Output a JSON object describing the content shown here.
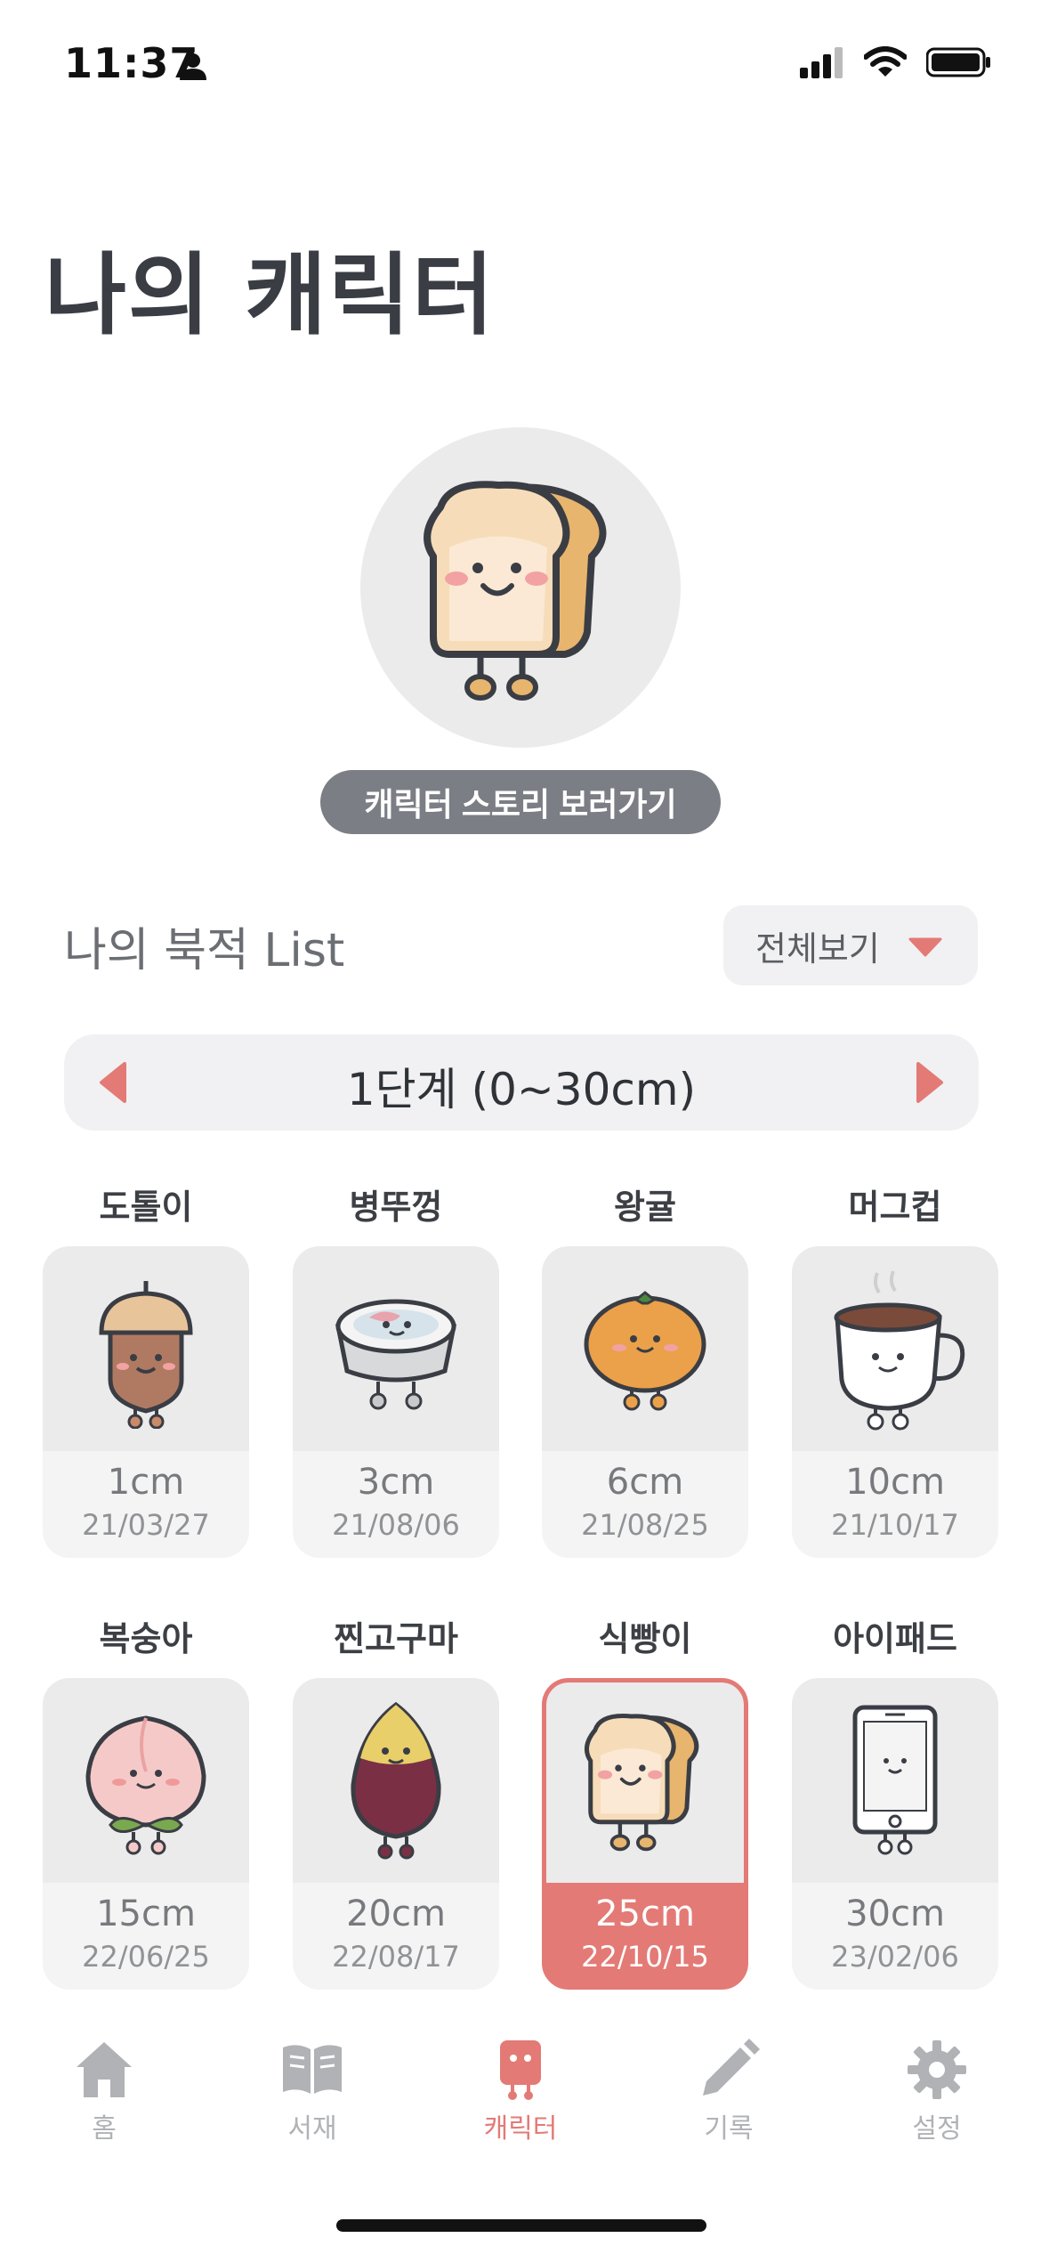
{
  "status": {
    "time": "11:37"
  },
  "page": {
    "title": "나의 캐릭터"
  },
  "hero": {
    "story_button": "캐릭터 스토리 보러가기"
  },
  "list": {
    "title": "나의 북적 List",
    "filter_label": "전체보기"
  },
  "level": {
    "label": "1단계 (0~30cm)"
  },
  "characters": [
    {
      "name": "도톨이",
      "size": "1cm",
      "date": "21/03/27"
    },
    {
      "name": "병뚜껑",
      "size": "3cm",
      "date": "21/08/06"
    },
    {
      "name": "왕귤",
      "size": "6cm",
      "date": "21/08/25"
    },
    {
      "name": "머그컵",
      "size": "10cm",
      "date": "21/10/17"
    },
    {
      "name": "복숭아",
      "size": "15cm",
      "date": "22/06/25"
    },
    {
      "name": "찐고구마",
      "size": "20cm",
      "date": "22/08/17"
    },
    {
      "name": "식빵이",
      "size": "25cm",
      "date": "22/10/15"
    },
    {
      "name": "아이패드",
      "size": "30cm",
      "date": "23/02/06"
    }
  ],
  "tabs": [
    {
      "label": "홈",
      "icon": "home-icon"
    },
    {
      "label": "서재",
      "icon": "book-icon"
    },
    {
      "label": "캐릭터",
      "icon": "character-icon"
    },
    {
      "label": "기록",
      "icon": "pencil-icon"
    },
    {
      "label": "설정",
      "icon": "gear-icon"
    }
  ],
  "colors": {
    "accent": "#e37a76",
    "muted": "#b0b2b5",
    "card_bg": "#ebebeb"
  }
}
